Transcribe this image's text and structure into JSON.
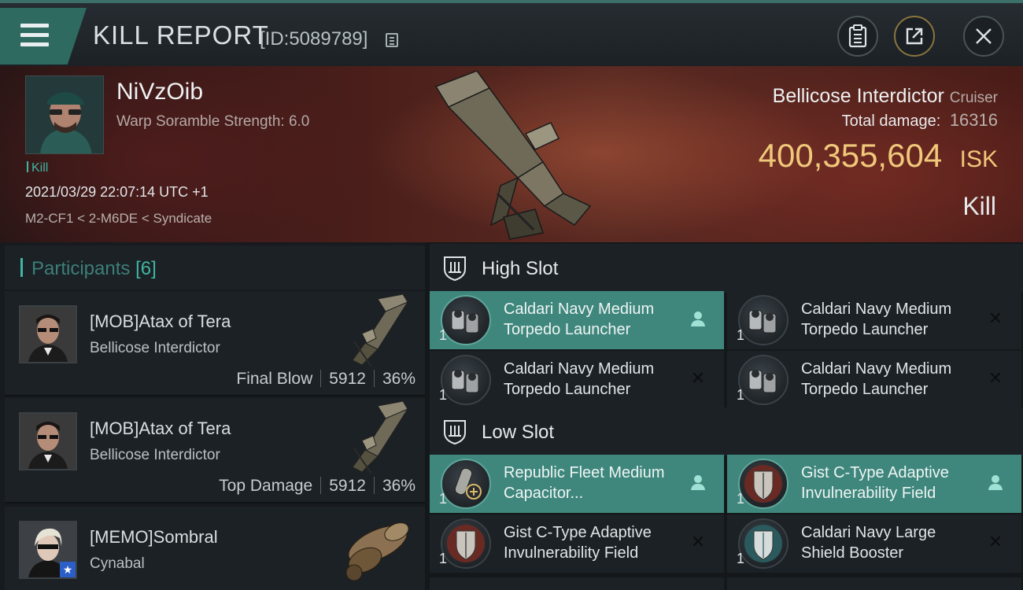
{
  "header": {
    "title": "KILL REPORT",
    "report_id": "[ID:5089789]"
  },
  "victim": {
    "name": "NiVzOib",
    "subtitle": "Warp Soramble Strength: 6.0",
    "tag": "Kill",
    "timestamp": "2021/03/29 22:07:14 UTC +1",
    "location": "M2-CF1 < 2-M6DE < Syndicate",
    "ship_name": "Bellicose Interdictor",
    "ship_class": "Cruiser",
    "total_damage_label": "Total damage:",
    "total_damage": "16316",
    "isk_value": "400,355,604",
    "isk_unit": "ISK",
    "result": "Kill"
  },
  "participants": {
    "label": "Participants",
    "count": "[6]",
    "rows": [
      {
        "name": "[MOB]Atax of Tera",
        "ship": "Bellicose Interdictor",
        "role": "Final Blow",
        "damage": "5912",
        "percent": "36%"
      },
      {
        "name": "[MOB]Atax of Tera",
        "ship": "Bellicose Interdictor",
        "role": "Top Damage",
        "damage": "5912",
        "percent": "36%"
      },
      {
        "name": "[MEMO]Sombral",
        "ship": "Cynabal"
      }
    ]
  },
  "slots": {
    "high": {
      "label": "High Slot",
      "items": [
        {
          "name": "Caldari Navy Medium Torpedo Launcher",
          "qty": "1",
          "status": "fitted"
        },
        {
          "name": "Caldari Navy Medium Torpedo Launcher",
          "qty": "1",
          "status": "destroyed"
        },
        {
          "name": "Caldari Navy Medium Torpedo Launcher",
          "qty": "1",
          "status": "destroyed"
        },
        {
          "name": "Caldari Navy Medium Torpedo Launcher",
          "qty": "1",
          "status": "destroyed"
        }
      ]
    },
    "low": {
      "label": "Low Slot",
      "items": [
        {
          "name": "Republic Fleet Medium Capacitor...",
          "qty": "1",
          "status": "fitted"
        },
        {
          "name": "Gist C-Type Adaptive Invulnerability Field",
          "qty": "1",
          "status": "fitted"
        },
        {
          "name": "Gist C-Type Adaptive Invulnerability Field",
          "qty": "1",
          "status": "destroyed"
        },
        {
          "name": "Caldari Navy Large Shield Booster",
          "qty": "1",
          "status": "destroyed"
        }
      ]
    }
  },
  "icons": {
    "menu": "menu-icon",
    "copy": "copy-icon",
    "clipboard": "clipboard-icon",
    "share": "share-icon",
    "close": "close-icon",
    "slot": "slot-shield-icon",
    "fitted": "pilot-icon",
    "destroyed": "x-icon"
  },
  "colors": {
    "accent": "#3fb6a4",
    "fitted_bg": "#3f877d",
    "isk": "#f0c87a"
  }
}
